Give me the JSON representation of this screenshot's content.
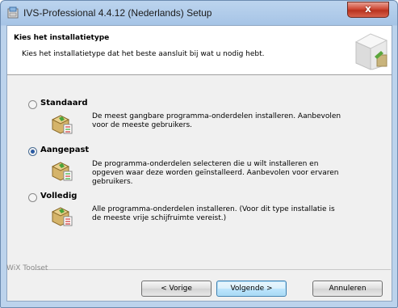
{
  "window": {
    "title": "IVS-Professional 4.4.12 (Nederlands) Setup",
    "close_label": "x"
  },
  "banner": {
    "title": "Kies het installatietype",
    "description": "Kies het installatietype dat het beste aansluit bij wat u nodig hebt."
  },
  "options": [
    {
      "label": "Standaard",
      "selected": false,
      "description_lines": [
        "De meest gangbare programma-onderdelen installeren. Aanbevolen",
        "voor de meeste gebruikers."
      ]
    },
    {
      "label": "Aangepast",
      "selected": true,
      "description_lines": [
        "De programma-onderdelen selecteren die u wilt installeren en",
        "opgeven waar deze worden geïnstalleerd. Aanbevolen voor ervaren",
        "gebruikers."
      ]
    },
    {
      "label": "Volledig",
      "selected": false,
      "description_lines": [
        "Alle programma-onderdelen installeren. (Voor dit type installatie is",
        "de meeste vrije schijfruimte vereist.)"
      ]
    }
  ],
  "footer": {
    "brand": "WiX Toolset"
  },
  "buttons": {
    "back": "< Vorige",
    "next": "Volgende >",
    "cancel": "Annuleren"
  },
  "colors": {
    "close_button": "#c7402b",
    "default_button_border": "#3c7fb1",
    "title_bar": "#a6c4e6"
  }
}
